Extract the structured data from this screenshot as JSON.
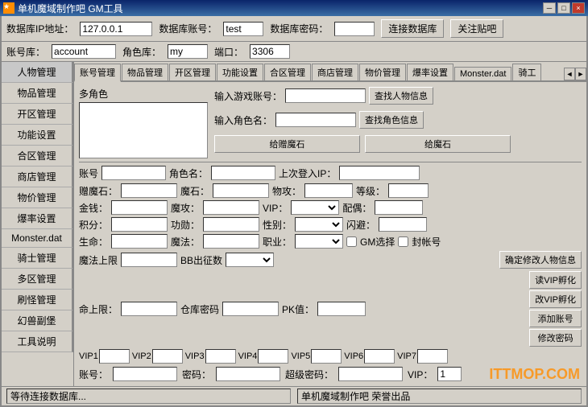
{
  "titlebar": {
    "icon": "★",
    "title": "单机魔域制作吧 GM工具",
    "min_label": "─",
    "restore_label": "□",
    "close_label": "×"
  },
  "topbar": {
    "db_ip_label": "数据库IP地址：",
    "db_ip_value": "127.0.0.1",
    "db_account_label": "数据库账号：",
    "db_account_value": "test",
    "db_password_label": "数据库密码：",
    "db_password_value": "****",
    "connect_btn": "连接数据库",
    "close_btn": "关注贴吧"
  },
  "secondbar": {
    "account_label": "账号库：",
    "account_value": "account",
    "role_label": "角色库：",
    "role_value": "my",
    "port_label": "端口：",
    "port_value": "3306"
  },
  "sidebar": {
    "items": [
      {
        "label": "人物管理"
      },
      {
        "label": "物品管理"
      },
      {
        "label": "开区管理"
      },
      {
        "label": "功能设置"
      },
      {
        "label": "合区管理"
      },
      {
        "label": "商店管理"
      },
      {
        "label": "物价管理"
      },
      {
        "label": "爆率设置"
      },
      {
        "label": "Monster.dat"
      },
      {
        "label": "骑士管理"
      },
      {
        "label": "多区管理"
      },
      {
        "label": "刷怪管理"
      },
      {
        "label": "幻兽副堡"
      },
      {
        "label": "工具说明"
      }
    ]
  },
  "tabs": {
    "items": [
      {
        "label": "账号管理",
        "active": true
      },
      {
        "label": "物品管理"
      },
      {
        "label": "开区管理"
      },
      {
        "label": "功能设置"
      },
      {
        "label": "合区管理"
      },
      {
        "label": "商店管理"
      },
      {
        "label": "物价管理"
      },
      {
        "label": "爆率设置"
      },
      {
        "label": "Monster.dat"
      },
      {
        "label": "骑工"
      }
    ]
  },
  "account_tab": {
    "multi_char_label": "多角色",
    "search_game_account_label": "输入游戏账号：",
    "search_game_account_value": "",
    "search_role_name_label": "输入角色名：",
    "search_role_name_value": "",
    "find_person_btn": "查找人物信息",
    "find_role_btn": "查找角色信息",
    "give_magic_stone_btn": "给赠魔石",
    "give_magic_stone_btn2": "给魔石",
    "separator": true,
    "account_label": "账号",
    "account_value": "",
    "role_name_label": "角色名：",
    "role_name_value": "",
    "last_ip_label": "上次登入IP：",
    "last_ip_value": "",
    "gift_stone_label": "赠魔石：",
    "gift_stone_value": "",
    "magic_stone_label": "魔石：",
    "magic_stone_value": "",
    "phy_atk_label": "物攻：",
    "phy_atk_value": "",
    "level_label": "等级：",
    "level_value": "",
    "money_label": "金钱：",
    "money_value": "",
    "magic_atk_label": "魔攻：",
    "magic_atk_value": "",
    "vip_label": "VIP：",
    "vip_value": "",
    "spouse_label": "配偶：",
    "spouse_value": "",
    "points_label": "积分：",
    "points_value": "",
    "merit_label": "功勋：",
    "merit_value": "",
    "gender_label": "性别：",
    "gender_value": "",
    "flash_label": "闪避：",
    "flash_value": "",
    "life_label": "生命：",
    "life_value": "",
    "magic_skill_label": "魔法：",
    "magic_skill_value": "",
    "job_label": "职业：",
    "job_value": "",
    "gm_select_label": "GM选择",
    "seal_account_label": "封帐号",
    "magic_max_label": "魔法上限",
    "magic_max_value": "",
    "bb_label": "BB出征数",
    "bb_value": "",
    "confirm_modify_btn": "确定修改人物信息",
    "life_max_label": "命上限：",
    "life_max_value": "",
    "warehouse_pwd_label": "仓库密码",
    "warehouse_pwd_value": "",
    "pk_label": "PK值：",
    "pk_value": "",
    "read_vip_btn": "读VIP孵化",
    "change_vip_btn": "改VIP孵化",
    "add_account_btn": "添加账号",
    "change_pwd_btn": "修改密码",
    "vip_fields": [
      {
        "label": "VIP1",
        "value": ""
      },
      {
        "label": "VIP2",
        "value": ""
      },
      {
        "label": "VIP3",
        "value": ""
      },
      {
        "label": "VIP4",
        "value": ""
      },
      {
        "label": "VIP5",
        "value": ""
      },
      {
        "label": "VIP6",
        "value": ""
      },
      {
        "label": "VIP7",
        "value": ""
      }
    ],
    "bottom_account_label": "账号：",
    "bottom_account_value": "",
    "bottom_pwd_label": "密码：",
    "bottom_pwd_value": "",
    "super_pwd_label": "超级密码：",
    "super_pwd_value": "",
    "bottom_vip_label": "VIP：",
    "bottom_vip_value": "1"
  },
  "statusbar": {
    "left": "等待连接数据库...",
    "right": "单机魔域制作吧 荣誉出品"
  },
  "watermark": "ITTMOP.COM"
}
